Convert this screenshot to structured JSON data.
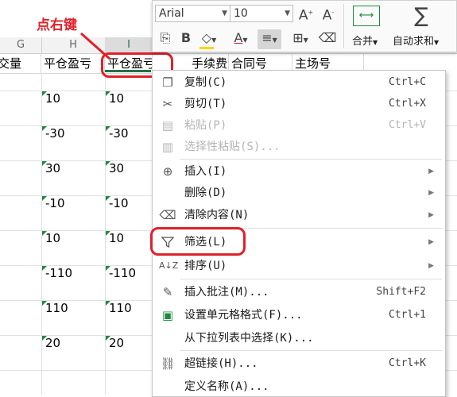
{
  "annotation": {
    "text": "点右键",
    "color": "#e0202a"
  },
  "columns": {
    "g": "G",
    "h": "H",
    "i": "I"
  },
  "headers": [
    "交量",
    "平仓盈亏",
    "平仓盈亏(",
    "手续费",
    "合同号",
    "主场号"
  ],
  "col_h_values": [
    "10",
    "-30",
    "30",
    "-10",
    "10",
    "-110",
    "110",
    "20"
  ],
  "col_i_values": [
    "10",
    "-30",
    "30",
    "-10",
    "10",
    "-110",
    "110",
    "20"
  ],
  "toolbar": {
    "font_name": "Arial",
    "font_size": "10",
    "merge_label": "合并",
    "autosum_label": "自动求和",
    "bold": "B",
    "font_color_letter": "A",
    "grow_font": "A",
    "shrink_font": "A"
  },
  "menu": {
    "copy": {
      "label": "复制(C)",
      "shortcut": "Ctrl+C"
    },
    "cut": {
      "label": "剪切(T)",
      "shortcut": "Ctrl+X"
    },
    "paste": {
      "label": "粘贴(P)",
      "shortcut": "Ctrl+V"
    },
    "paste_special": {
      "label": "选择性粘贴(S)..."
    },
    "insert": {
      "label": "插入(I)"
    },
    "delete": {
      "label": "删除(D)"
    },
    "clear": {
      "label": "清除内容(N)"
    },
    "filter": {
      "label": "筛选(L)"
    },
    "sort": {
      "label": "排序(U)"
    },
    "insert_comment": {
      "label": "插入批注(M)...",
      "shortcut": "Shift+F2"
    },
    "format_cells": {
      "label": "设置单元格格式(F)...",
      "shortcut": "Ctrl+1"
    },
    "pick_list": {
      "label": "从下拉列表中选择(K)..."
    },
    "hyperlink": {
      "label": "超链接(H)...",
      "shortcut": "Ctrl+K"
    },
    "define_name": {
      "label": "定义名称(A)..."
    }
  },
  "colors": {
    "accent_green": "#217346",
    "annotation_red": "#e0202a"
  }
}
